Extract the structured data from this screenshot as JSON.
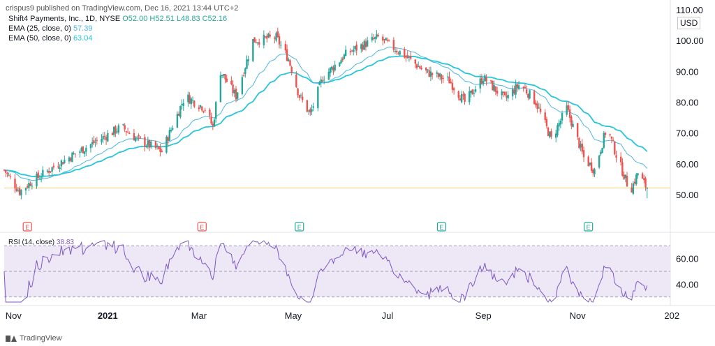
{
  "header": {
    "published": "crispus9 published on TradingView.com, Dec 16, 2021 13:44 UTC+2",
    "symbol": "Shift4 Payments, Inc., 1D, NYSE",
    "ohlc": "O52.00 H52.51 L48.83 C52.16",
    "ema25_label": "EMA (25, close, 0)",
    "ema25_value": "57.39",
    "ema50_label": "EMA (50, close, 0)",
    "ema50_value": "63.04",
    "currency": "USD"
  },
  "rsi_label": "RSI (14, close)",
  "rsi_value": "38.83",
  "footer_logo": "TradingView",
  "colors": {
    "up": "#26a69a",
    "down": "#ef5350",
    "ema25": "#4db6e0",
    "ema50": "#26c6da",
    "rsi": "#7e57c2",
    "rsi_band": "#ede7f6"
  },
  "chart_data": [
    {
      "type": "candlestick",
      "x_range": [
        "2020-10-26",
        "2021-12-31"
      ],
      "ylim": [
        43,
        110
      ],
      "yticks": [
        "50.00",
        "60.00",
        "70.00",
        "80.00",
        "90.00",
        "100.00",
        "110.00"
      ],
      "ytick_values": [
        50,
        60,
        70,
        80,
        90,
        100,
        110
      ],
      "xticks": [
        "Nov",
        "2021",
        "Mar",
        "May",
        "Jul",
        "Sep",
        "Nov",
        "202"
      ],
      "xtick_dates": [
        "2020-11-01",
        "2021-01-01",
        "2021-03-01",
        "2021-05-01",
        "2021-07-01",
        "2021-09-01",
        "2021-11-01",
        "2022-01-01"
      ],
      "last_price_line": 52.16,
      "close_path": [
        [
          "2020-10-26",
          58
        ],
        [
          "2020-11-05",
          51
        ],
        [
          "2020-11-12",
          54
        ],
        [
          "2020-11-30",
          60
        ],
        [
          "2020-12-20",
          66
        ],
        [
          "2021-01-10",
          72
        ],
        [
          "2021-01-20",
          68
        ],
        [
          "2021-02-05",
          64
        ],
        [
          "2021-02-20",
          82
        ],
        [
          "2021-03-05",
          78
        ],
        [
          "2021-03-10",
          72
        ],
        [
          "2021-03-15",
          90
        ],
        [
          "2021-03-25",
          82
        ],
        [
          "2021-04-05",
          100
        ],
        [
          "2021-04-20",
          101
        ],
        [
          "2021-04-28",
          94
        ],
        [
          "2021-05-05",
          82
        ],
        [
          "2021-05-12",
          76
        ],
        [
          "2021-05-20",
          88
        ],
        [
          "2021-06-05",
          96
        ],
        [
          "2021-06-25",
          101
        ],
        [
          "2021-07-10",
          96
        ],
        [
          "2021-07-25",
          90
        ],
        [
          "2021-08-10",
          87
        ],
        [
          "2021-08-20",
          80
        ],
        [
          "2021-09-01",
          88
        ],
        [
          "2021-09-15",
          81
        ],
        [
          "2021-09-25",
          86
        ],
        [
          "2021-10-05",
          80
        ],
        [
          "2021-10-15",
          68
        ],
        [
          "2021-10-25",
          78
        ],
        [
          "2021-11-05",
          62
        ],
        [
          "2021-11-12",
          58
        ],
        [
          "2021-11-20",
          72
        ],
        [
          "2021-11-26",
          63
        ],
        [
          "2021-12-05",
          51
        ],
        [
          "2021-12-10",
          57
        ],
        [
          "2021-12-16",
          52
        ]
      ],
      "last_candle": {
        "date": "2021-12-16",
        "open": 52.0,
        "high": 52.51,
        "low": 48.83,
        "close": 52.16
      },
      "ema25_last": 57.39,
      "ema50_last": 63.04,
      "earnings_markers": [
        {
          "date": "2020-11-10",
          "label": "E",
          "kind": "down"
        },
        {
          "date": "2021-03-03",
          "label": "E",
          "kind": "down"
        },
        {
          "date": "2021-05-05",
          "label": "E",
          "kind": "up"
        },
        {
          "date": "2021-08-05",
          "label": "E",
          "kind": "up"
        },
        {
          "date": "2021-11-08",
          "label": "E",
          "kind": "up"
        }
      ]
    },
    {
      "type": "line",
      "series_name": "RSI (14, close)",
      "ylim": [
        26,
        74
      ],
      "yticks": [
        "40.00",
        "60.00"
      ],
      "ytick_values": [
        40,
        60
      ],
      "band": [
        30,
        70
      ],
      "midline": 50,
      "last_value": 38.83
    }
  ]
}
